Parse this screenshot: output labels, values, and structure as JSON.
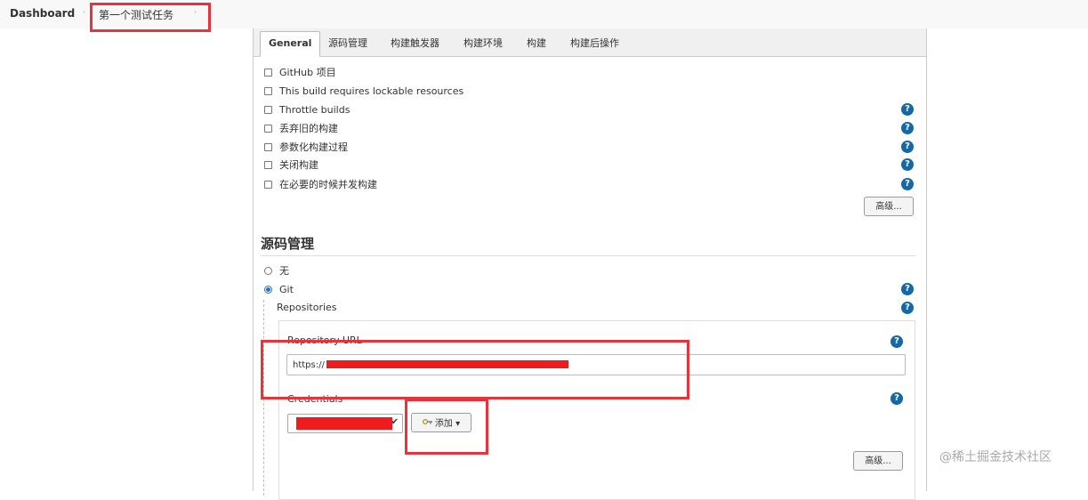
{
  "breadcrumb": {
    "dashboard": "Dashboard",
    "sep": "›",
    "job": "第一个测试任务"
  },
  "tabs": [
    "General",
    "源码管理",
    "构建触发器",
    "构建环境",
    "构建",
    "构建后操作"
  ],
  "general": {
    "options": [
      "GitHub 项目",
      "This build requires lockable resources",
      "Throttle builds",
      "丢弃旧的构建",
      "参数化构建过程",
      "关闭构建",
      "在必要的时候并发构建"
    ],
    "advanced_label": "高级..."
  },
  "scm": {
    "title": "源码管理",
    "none_label": "无",
    "git_label": "Git",
    "repositories_label": "Repositories",
    "repo_url_label": "Repository URL",
    "repo_url_value": "https://",
    "credentials_label": "Credentials",
    "add_label": "添加",
    "add_caret": "▾",
    "select_caret": "✔",
    "advanced_label": "高级..."
  },
  "help_glyph": "?",
  "watermark": "@稀土掘金技术社区",
  "colors": {
    "annotation": "#e8333c",
    "help": "#1468a6",
    "redaction": "#ee1c1c"
  }
}
